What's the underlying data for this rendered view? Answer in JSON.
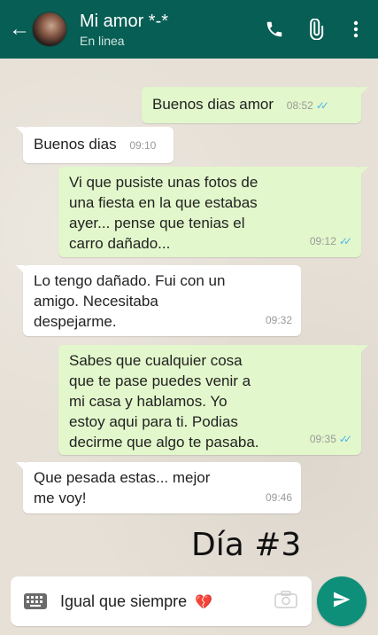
{
  "header": {
    "contact_name": "Mi amor *-*",
    "status": "En linea"
  },
  "messages": [
    {
      "direction": "out",
      "text": "Buenos dias amor",
      "time": "08:52",
      "read": true
    },
    {
      "direction": "in",
      "text": "Buenos dias",
      "time": "09:10"
    },
    {
      "direction": "out",
      "text": "Vi que pusiste unas fotos de\nuna fiesta en la que estabas\nayer... pense que tenias el\ncarro dañado...",
      "time": "09:12",
      "read": true
    },
    {
      "direction": "in",
      "text": "Lo tengo dañado. Fui con un\namigo. Necesitaba\ndespejarme.",
      "time": "09:32"
    },
    {
      "direction": "out",
      "text": "Sabes que cualquier cosa\nque te pase puedes venir a\nmi casa y hablamos. Yo\nestoy aqui para ti. Podias\ndecirme que algo te pasaba.",
      "time": "09:35",
      "read": true
    },
    {
      "direction": "in",
      "text": "Que pesada estas... mejor\nme voy!",
      "time": "09:46"
    }
  ],
  "overlay_label": "Día #3",
  "composer": {
    "text": "Igual que siempre",
    "emoji": "💔"
  },
  "icons": {
    "back": "arrow-left-icon",
    "call": "phone-icon",
    "attach": "paperclip-icon",
    "menu": "more-vertical-icon",
    "keyboard": "keyboard-icon",
    "camera": "camera-icon",
    "send": "send-icon",
    "read_receipt": "double-check-icon"
  },
  "colors": {
    "header": "#075e54",
    "outgoing_bubble": "#e2f7cb",
    "incoming_bubble": "#ffffff",
    "read_ticks": "#4fb6ec",
    "send_button": "#0d8f7a"
  }
}
